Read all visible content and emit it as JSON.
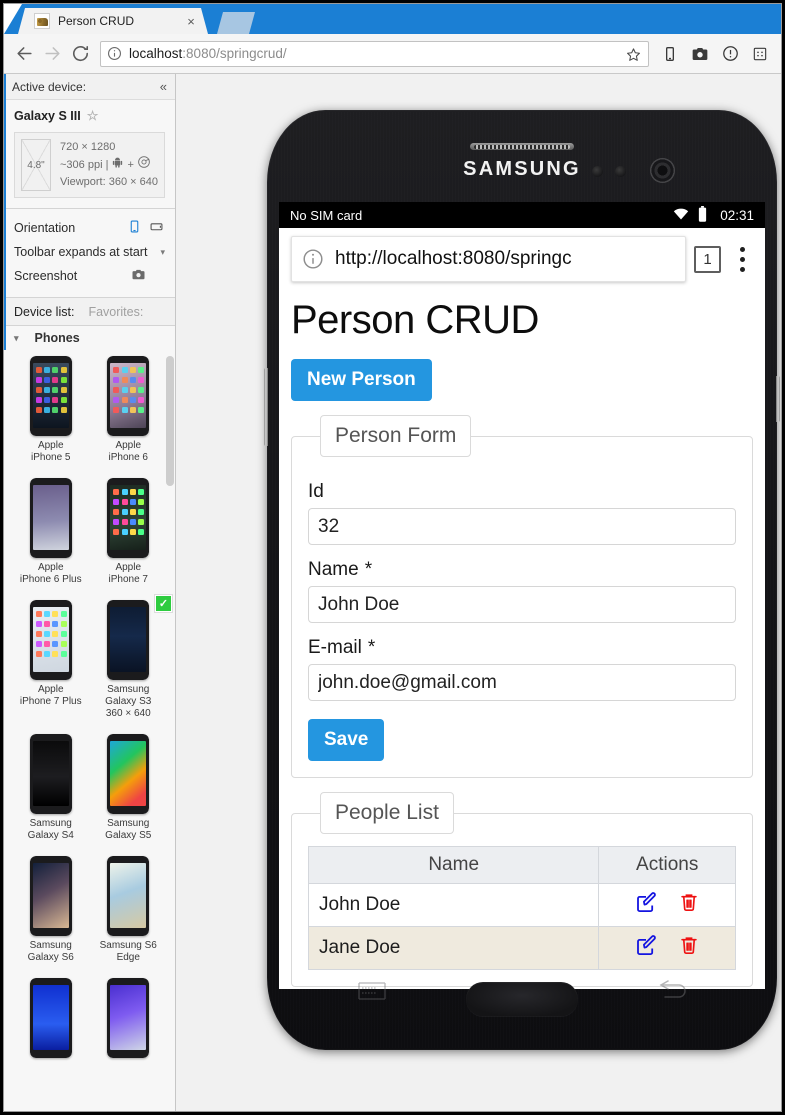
{
  "browser": {
    "tab": {
      "title": "Person CRUD",
      "close_label": "×",
      "favicon": "tomcat-favicon"
    },
    "new_tab_label": "",
    "nav": {
      "back": "←",
      "forward": "→",
      "reload": "⟳"
    },
    "omnibox": {
      "host": "localhost",
      "rest": ":8080/springcrud/",
      "info_icon": "info-circle-icon",
      "star_icon": "star-icon"
    },
    "toolbar_icons": [
      "device-toolbar-icon",
      "camera-icon",
      "alert-circle-icon",
      "apps-grid-icon"
    ]
  },
  "devtools": {
    "active_device_header": "Active device:",
    "collapse_label": "«",
    "device_name": "Galaxy S III",
    "favorite_icon": "star-outline-icon",
    "spec": {
      "diagonal": "4.8\"",
      "resolution": "720 × 1280",
      "ppi": "~306 ppi |",
      "os_icons": "android-icon + chrome-icon",
      "plus": "+",
      "viewport": "Viewport: 360 × 640"
    },
    "controls": {
      "orientation_label": "Orientation",
      "orientation_portrait_icon": "portrait-icon",
      "orientation_landscape_icon": "landscape-icon",
      "toolbar_label": "Toolbar expands at start",
      "toolbar_caret": "▾",
      "screenshot_label": "Screenshot",
      "screenshot_icon": "camera-icon"
    },
    "list_tabs": {
      "device_list": "Device list:",
      "favorites": "Favorites:"
    },
    "group": {
      "caret": "▾",
      "label": "Phones"
    },
    "devices": [
      {
        "label": "Apple\niPhone 5",
        "selected": false,
        "screen": "iphone5"
      },
      {
        "label": "Apple\niPhone 6",
        "selected": false,
        "screen": "iphone6"
      },
      {
        "label": "Apple\niPhone 6 Plus",
        "selected": false,
        "screen": "iphone6plus"
      },
      {
        "label": "Apple\niPhone 7",
        "selected": false,
        "screen": "iphone7"
      },
      {
        "label": "Apple\niPhone 7 Plus",
        "selected": false,
        "screen": "iphone7plus"
      },
      {
        "label": "Samsung\nGalaxy S3\n360 × 640",
        "selected": true,
        "screen": "galaxys3"
      },
      {
        "label": "Samsung\nGalaxy S4",
        "selected": false,
        "screen": "galaxys4"
      },
      {
        "label": "Samsung\nGalaxy S5",
        "selected": false,
        "screen": "galaxys5"
      },
      {
        "label": "Samsung\nGalaxy S6",
        "selected": false,
        "screen": "galaxys6"
      },
      {
        "label": "Samsung S6\nEdge",
        "selected": false,
        "screen": "galaxys6edge"
      },
      {
        "label": "",
        "selected": false,
        "screen": "galaxys7"
      },
      {
        "label": "",
        "selected": false,
        "screen": "galaxynote5"
      }
    ]
  },
  "phone": {
    "brand": "SAMSUNG",
    "statusbar": {
      "sim": "No SIM card",
      "wifi_icon": "wifi-icon",
      "battery_icon": "battery-icon",
      "clock": "02:31"
    },
    "mobile_browser": {
      "info_icon": "info-circle-icon",
      "url": "http://localhost:8080/springc",
      "tab_count": "1",
      "menu_icon": "kebab-menu-icon"
    },
    "softkeys": {
      "menu": "menu-softkey-icon",
      "back": "back-softkey-icon",
      "home": "home-button"
    }
  },
  "page": {
    "title": "Person CRUD",
    "new_person_button": "New Person",
    "form": {
      "legend": "Person Form",
      "fields": [
        {
          "label": "Id",
          "required": "",
          "value": "32",
          "name": "id"
        },
        {
          "label": "Name",
          "required": "*",
          "value": "John Doe",
          "name": "name"
        },
        {
          "label": "E-mail",
          "required": "*",
          "value": "john.doe@gmail.com",
          "name": "email"
        }
      ],
      "save_button": "Save"
    },
    "list": {
      "legend": "People List",
      "headers": [
        "Name",
        "Actions"
      ],
      "rows": [
        {
          "name": "John Doe",
          "edit_icon": "edit-icon",
          "delete_icon": "trash-icon"
        },
        {
          "name": "Jane Doe",
          "edit_icon": "edit-icon",
          "delete_icon": "trash-icon"
        }
      ]
    }
  },
  "colors": {
    "accent_blue": "#2496e0",
    "chrome_blue": "#1b7fd4",
    "edit_blue": "#1414e0",
    "delete_red": "#ee1111",
    "row_alt": "#efeade"
  }
}
